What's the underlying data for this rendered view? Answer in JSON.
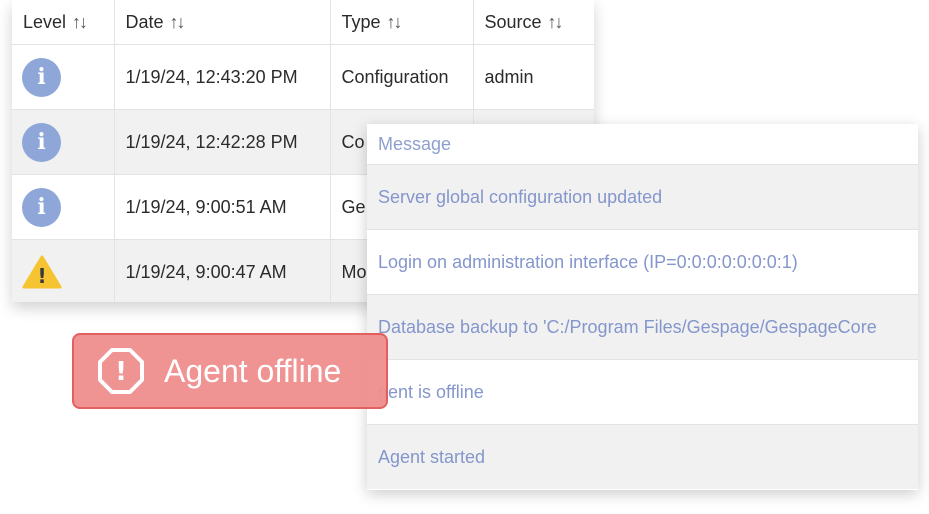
{
  "events_table": {
    "columns": [
      {
        "label": "Level",
        "sort_icon": "↑↓"
      },
      {
        "label": "Date",
        "sort_icon": "↑↓"
      },
      {
        "label": "Type",
        "sort_icon": "↑↓"
      },
      {
        "label": "Source",
        "sort_icon": "↑↓"
      }
    ],
    "rows": [
      {
        "level": "info",
        "level_glyph": "i",
        "date": "1/19/24, 12:43:20 PM",
        "type": "Configuration",
        "source": "admin"
      },
      {
        "level": "info",
        "level_glyph": "i",
        "date": "1/19/24, 12:42:28 PM",
        "type": "Co",
        "source": ""
      },
      {
        "level": "info",
        "level_glyph": "i",
        "date": "1/19/24, 9:00:51 AM",
        "type": "Ge",
        "source": ""
      },
      {
        "level": "warning",
        "level_glyph": "!",
        "date": "1/19/24, 9:00:47 AM",
        "type": "Mo",
        "source": ""
      }
    ]
  },
  "message_panel": {
    "header": "Message",
    "rows": [
      "Server global configuration updated",
      "Login on administration interface (IP=0:0:0:0:0:0:0:1)",
      "Database backup to 'C:/Program Files/Gespage/GespageCore",
      "gent is offline",
      "Agent started"
    ]
  },
  "agent_badge": {
    "label": "Agent offline",
    "icon": "alert-octagon-icon",
    "icon_glyph": "!"
  },
  "colors": {
    "info": "#8ea7d8",
    "warning": "#f5c430",
    "badge_bg": "#ef8f8f",
    "badge_border": "#e35a5a",
    "message_text": "#8496cc"
  }
}
